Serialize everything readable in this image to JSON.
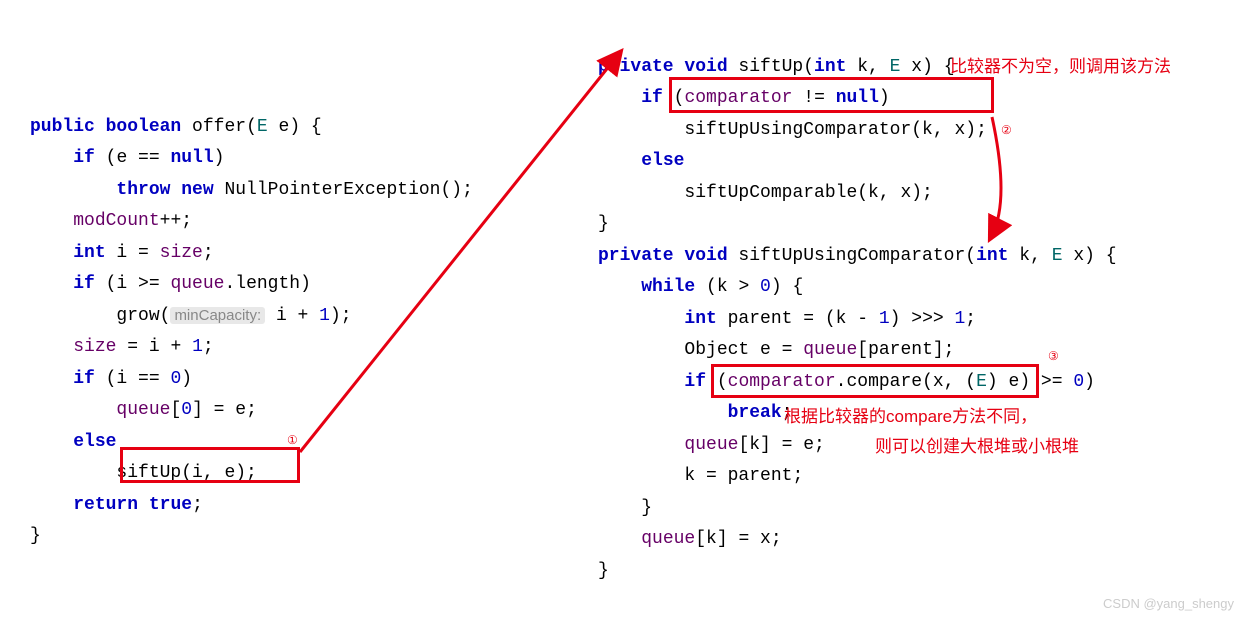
{
  "left": {
    "sig_mods": "public boolean",
    "fn": "offer",
    "paramsType": "E",
    "paramsName": "e",
    "l1a": "if",
    "l1b": "(e == ",
    "l1c": "null",
    "l1d": ")",
    "l2a": "throw new",
    "l2b": " NullPointerException();",
    "l3a": "modCount",
    "l3b": "++;",
    "l4a": "int",
    "l4b": " i = ",
    "l4c": "size",
    "l4d": ";",
    "l5a": "if",
    "l5b": " (i >= ",
    "l5c": "queue",
    "l5d": ".length)",
    "l6a": "grow(",
    "l6hint": "minCapacity:",
    "l6b": " i + ",
    "l6c": "1",
    "l6d": ");",
    "l7a": "size",
    "l7b": " = i + ",
    "l7c": "1",
    "l7d": ";",
    "l8a": "if",
    "l8b": " (i == ",
    "l8c": "0",
    "l8d": ")",
    "l9a": "queue",
    "l9b": "[",
    "l9c": "0",
    "l9d": "] = e;",
    "l10": "else",
    "l11": "siftUp(i, e);",
    "l12a": "return",
    "l12b": " ",
    "l12c": "true",
    "l12d": ";",
    "close": "}"
  },
  "right": {
    "a_sig1": "private void",
    "a_fn": " siftUp(",
    "a_p1a": "int",
    "a_p1b": " k, ",
    "a_p1c": "E",
    "a_p1d": " x) {",
    "a_l1a": "if",
    "a_l1b": " (",
    "a_l1c": "comparator",
    "a_l1d": " != ",
    "a_l1e": "null",
    "a_l1f": ")",
    "a_l2": "siftUpUsingComparator(k, x);",
    "a_l3": "else",
    "a_l4": "siftUpComparable(k, x);",
    "a_close": "}",
    "b_sig1": "private void",
    "b_fn": " siftUpUsingComparator(",
    "b_p1a": "int",
    "b_p1b": " k, ",
    "b_p1c": "E",
    "b_p1d": " x) {",
    "b_l1a": "while",
    "b_l1b": " (k > ",
    "b_l1c": "0",
    "b_l1d": ") {",
    "b_l2a": "int",
    "b_l2b": " parent = (k - ",
    "b_l2c": "1",
    "b_l2d": ") >>> ",
    "b_l2e": "1",
    "b_l2f": ";",
    "b_l3a": "Object e = ",
    "b_l3b": "queue",
    "b_l3c": "[parent];",
    "b_l4a": "if",
    "b_l4b": " (",
    "b_l4c": "comparator",
    "b_l4d": ".compare(x, (",
    "b_l4e": "E",
    "b_l4f": ") e) >= ",
    "b_l4g": "0",
    "b_l4h": ")",
    "b_l5": "break",
    "b_l5b": ";",
    "b_l6a": "queue",
    "b_l6b": "[k] = e;",
    "b_l7": "k = parent;",
    "b_l8": "}",
    "b_l9a": "queue",
    "b_l9b": "[k] = x;",
    "b_close": "}"
  },
  "annotations": {
    "circ1": "①",
    "circ2": "②",
    "circ3": "③",
    "note1": "比较器不为空，则调用该方法",
    "note2a": "根据比较器的compare方法不同，",
    "note2b": "则可以创建大根堆或小根堆",
    "watermark": "CSDN @yang_shengy"
  }
}
